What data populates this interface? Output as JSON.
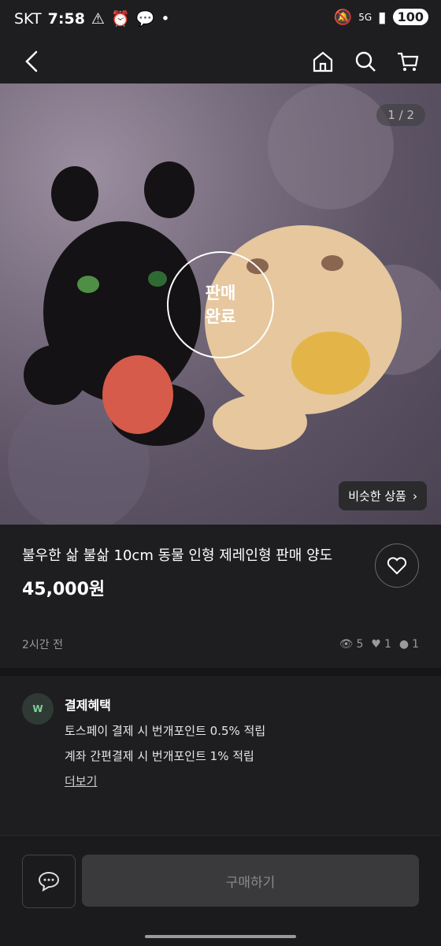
{
  "status": {
    "carrier": "SKT",
    "time": "7:58",
    "battery": "100",
    "network": "5G"
  },
  "header": {
    "icons": [
      "back-icon",
      "home-icon",
      "search-icon",
      "cart-icon"
    ]
  },
  "photo": {
    "counter": "1 / 2",
    "sold_line1": "판매",
    "sold_line2": "완료",
    "similar_label": "비슷한 상품"
  },
  "product": {
    "title": "불우한 삶 불삶 10cm 동물 인형 제레인형 판매 양도",
    "price": "45,000원",
    "posted": "2시간 전",
    "views": "5",
    "likes": "1",
    "chats": "1"
  },
  "benefit": {
    "title": "결제혜택",
    "line1": "토스페이 결제 시 번개포인트 0.5% 적립",
    "line2": "계좌 간편결제 시 번개포인트 1% 적립",
    "more": "더보기",
    "icon_text": "W"
  },
  "bottom": {
    "buy_label": "구매하기"
  },
  "colors": {
    "background": "#1e1e20",
    "accent_green": "#2f3a34"
  }
}
